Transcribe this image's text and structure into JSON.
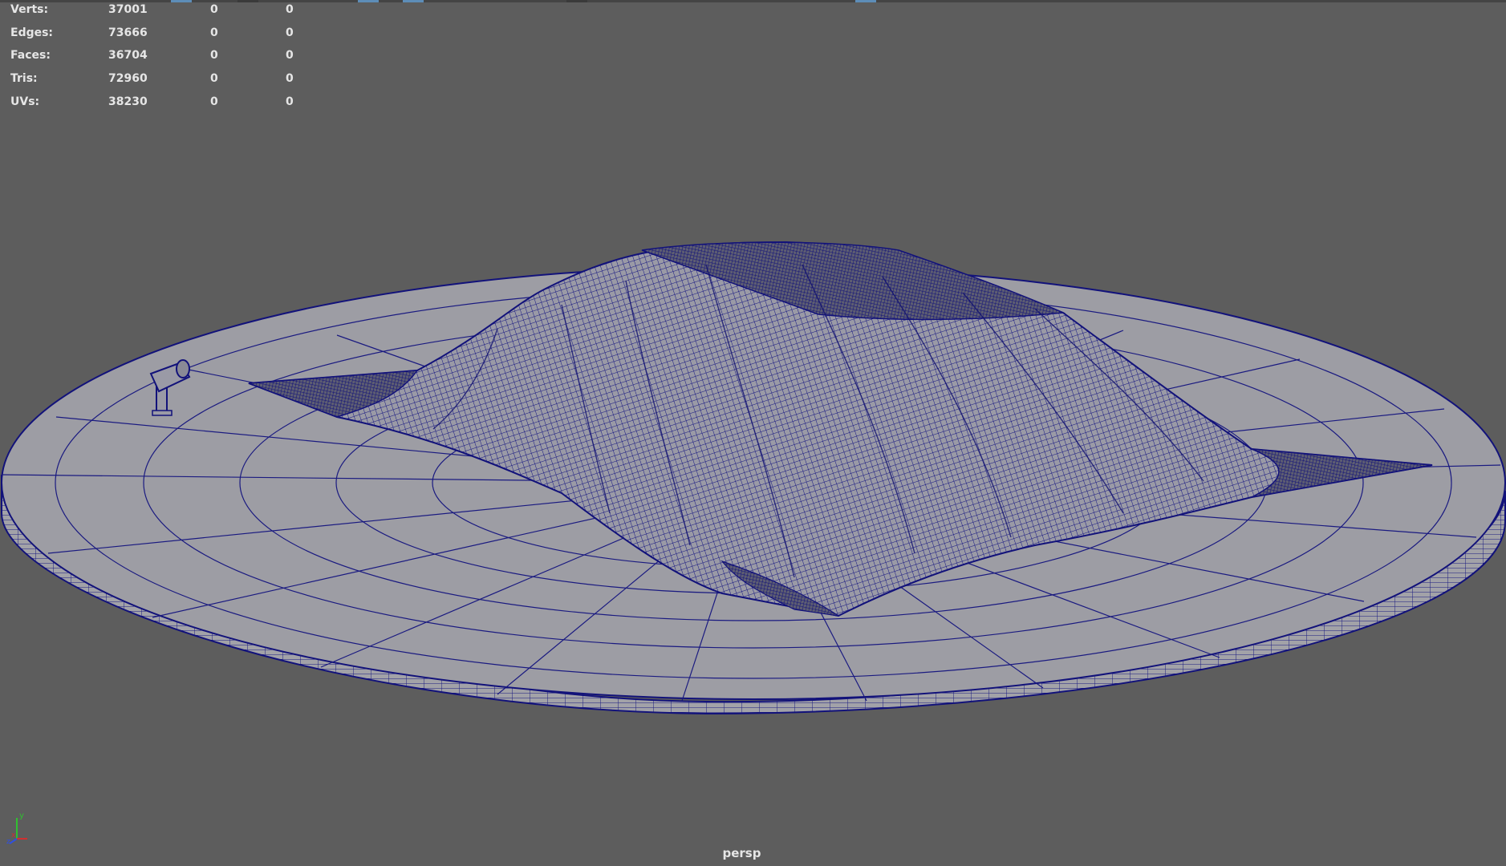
{
  "hud": {
    "rows": [
      {
        "label": "Verts:",
        "values": [
          "37001",
          "0",
          "0"
        ]
      },
      {
        "label": "Edges:",
        "values": [
          "73666",
          "0",
          "0"
        ]
      },
      {
        "label": "Faces:",
        "values": [
          "36704",
          "0",
          "0"
        ]
      },
      {
        "label": "Tris:",
        "values": [
          "72960",
          "0",
          "0"
        ]
      },
      {
        "label": "UVs:",
        "values": [
          "38230",
          "0",
          "0"
        ]
      }
    ]
  },
  "viewport": {
    "camera_name": "persp",
    "background_color": "#5d5d5d",
    "wireframe_color": "#12127a",
    "mesh_fill_color": "#9b9ba6"
  },
  "axis_gizmo": {
    "labels": [
      "y",
      "x",
      "z"
    ],
    "colors": {
      "x": "#d03030",
      "y": "#30c030",
      "z": "#3050e0"
    }
  }
}
